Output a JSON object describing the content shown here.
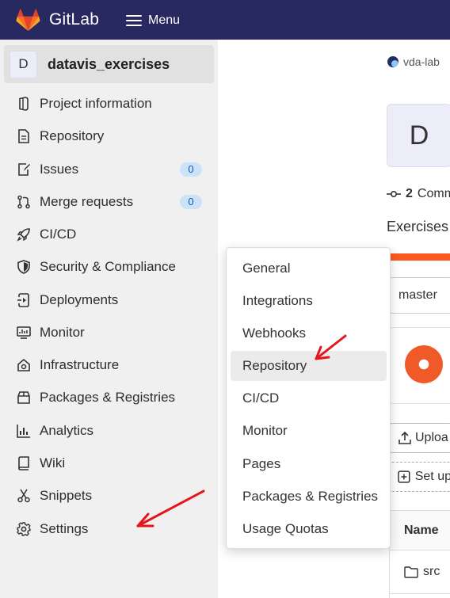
{
  "topbar": {
    "brand": "GitLab",
    "menu_label": "Menu"
  },
  "project": {
    "avatar_letter": "D",
    "name": "datavis_exercises"
  },
  "sidebar": {
    "items": [
      {
        "label": "Project information",
        "icon": "project-info-icon"
      },
      {
        "label": "Repository",
        "icon": "document-icon"
      },
      {
        "label": "Issues",
        "icon": "issues-icon",
        "badge": "0"
      },
      {
        "label": "Merge requests",
        "icon": "merge-request-icon",
        "badge": "0"
      },
      {
        "label": "CI/CD",
        "icon": "rocket-icon"
      },
      {
        "label": "Security & Compliance",
        "icon": "shield-icon"
      },
      {
        "label": "Deployments",
        "icon": "deployments-icon"
      },
      {
        "label": "Monitor",
        "icon": "monitor-icon"
      },
      {
        "label": "Infrastructure",
        "icon": "infrastructure-icon"
      },
      {
        "label": "Packages & Registries",
        "icon": "package-icon"
      },
      {
        "label": "Analytics",
        "icon": "chart-icon"
      },
      {
        "label": "Wiki",
        "icon": "book-icon"
      },
      {
        "label": "Snippets",
        "icon": "scissors-icon"
      },
      {
        "label": "Settings",
        "icon": "gear-icon"
      }
    ]
  },
  "settings_menu": {
    "items": [
      "General",
      "Integrations",
      "Webhooks",
      "Repository",
      "CI/CD",
      "Monitor",
      "Pages",
      "Packages & Registries",
      "Usage Quotas"
    ],
    "hovered": "Repository"
  },
  "main": {
    "breadcrumb_group": "vda-lab",
    "avatar_letter": "D",
    "commits_count": "2",
    "commits_label": "Comm",
    "description": "Exercises",
    "branch": "master",
    "upload_label": "Uploa",
    "setup_label": "Set up",
    "table_header": "Name",
    "files": [
      "src"
    ]
  },
  "colors": {
    "topbar": "#292961",
    "sidebar": "#f0f0f0",
    "badge_bg": "#cbe2f9",
    "annotation_arrow": "#e8141b",
    "language_bar": "#fc5a1f"
  }
}
